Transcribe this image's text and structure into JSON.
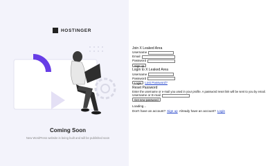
{
  "logo": {
    "text": "HOSTINGER"
  },
  "coming_soon": {
    "title": "Coming Soon",
    "subtitle": "New WordPress website is being built and will be published soon"
  },
  "join": {
    "title": "Join X Leaked Area",
    "username_label": "Username",
    "email_label": "Email",
    "password_label": "Password",
    "signup_button": "Sign up"
  },
  "login": {
    "title": "Login to X Leaked Area",
    "username_label": "Username",
    "password_label": "Password",
    "login_button": "Login",
    "lost_password_link": "Lost Password?"
  },
  "reset": {
    "title": "Reset Password",
    "instructions": "Enter the username or e-mail you used in your profile. A password reset link will be sent to you by email.",
    "field_label": "Username or E-mail",
    "button": "Get new password"
  },
  "footer": {
    "loading": "Loading...",
    "no_account": "Don't have an account?",
    "signup_link": "Sign up",
    "have_account": "Already have an account?",
    "login_link": "Login"
  },
  "colors": {
    "accent": "#673de6",
    "panel_bg": "#f3f3fb",
    "link": "#1a3cc8"
  }
}
